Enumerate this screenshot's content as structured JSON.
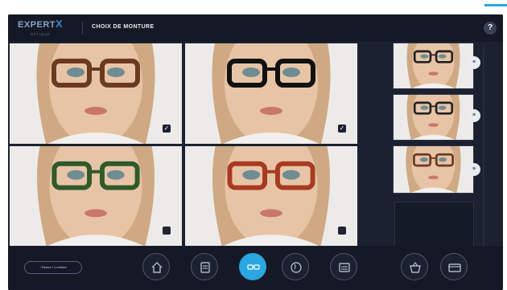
{
  "header": {
    "logo_main": "EXPERT",
    "logo_mark": "X",
    "logo_sub": "OPTIQUE",
    "title": "CHOIX DE MONTURE",
    "help_label": "?"
  },
  "colors": {
    "accent": "#2aa6e0",
    "background": "#1b2130",
    "bar": "#141925",
    "frame_brown": "#6b3a22",
    "frame_black": "#111111",
    "frame_green": "#2f5a2a",
    "frame_red": "#a83a22"
  },
  "main_tiles": [
    {
      "frame_color": "#6b3a22",
      "checked": true,
      "check_glyph": "✓"
    },
    {
      "frame_color": "#111111",
      "checked": true,
      "check_glyph": "✓"
    },
    {
      "frame_color": "#2f5a2a",
      "checked": false,
      "check_glyph": ""
    },
    {
      "frame_color": "#a83a22",
      "checked": false,
      "check_glyph": ""
    }
  ],
  "thumbnails": [
    {
      "frame_color": "#222222",
      "button": "≡"
    },
    {
      "frame_color": "#222222",
      "button": "≡"
    },
    {
      "frame_color": "#6b3a22",
      "button": "≡"
    }
  ],
  "footer": {
    "back_label": "‹ Retour / Lunettes",
    "nav": [
      {
        "icon": "home-icon",
        "active": false
      },
      {
        "icon": "clipboard-icon",
        "active": false
      },
      {
        "icon": "glasses-icon",
        "active": true
      },
      {
        "icon": "face-icon",
        "active": false
      },
      {
        "icon": "gallery-icon",
        "active": false
      },
      {
        "icon": "basket-icon",
        "active": false
      },
      {
        "icon": "card-icon",
        "active": false
      }
    ]
  }
}
